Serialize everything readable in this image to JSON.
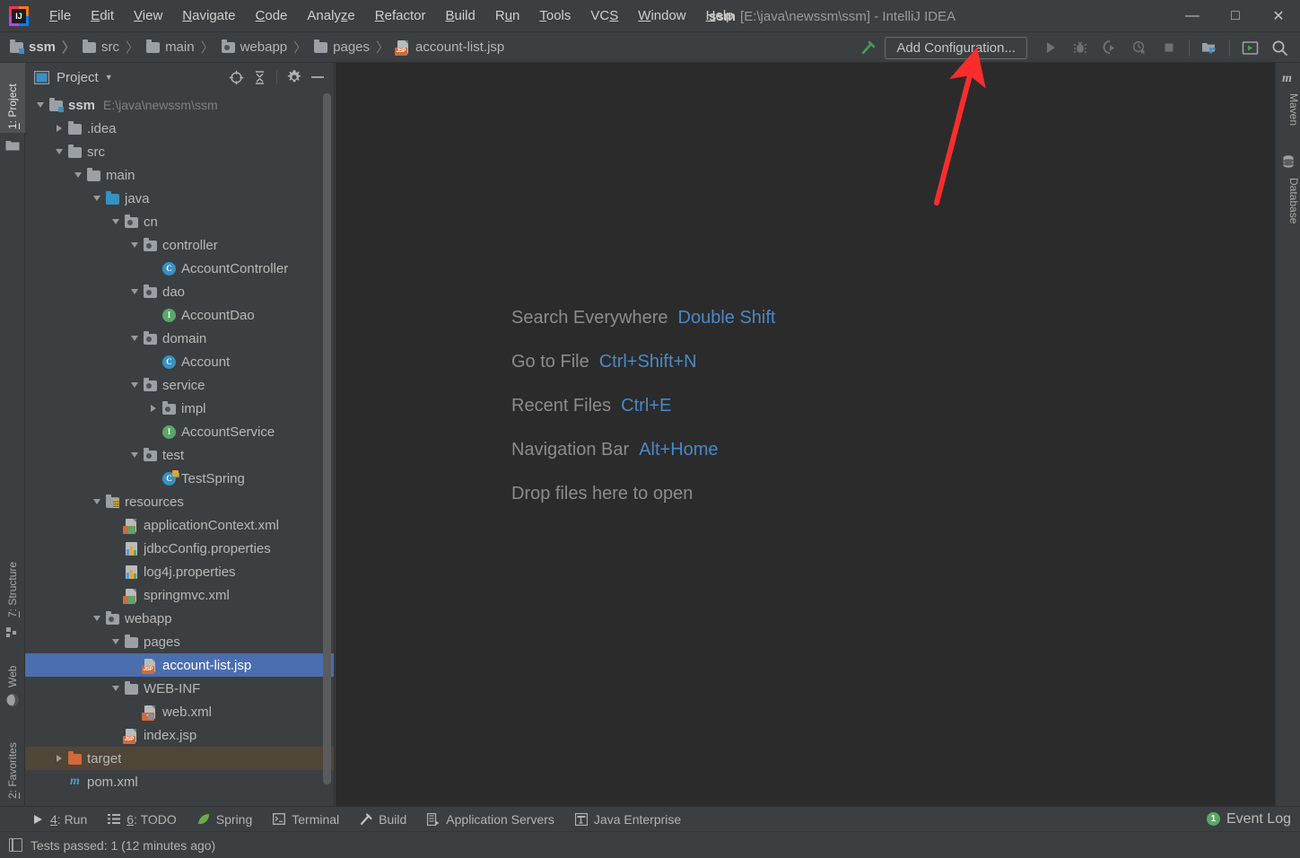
{
  "window": {
    "title_project": "ssm",
    "title_rest": "[E:\\java\\newssm\\ssm] - IntelliJ IDEA",
    "minimize": "—",
    "maximize": "□",
    "close": "✕"
  },
  "menubar": {
    "items": [
      {
        "label": "File",
        "mnemonic": "F"
      },
      {
        "label": "Edit",
        "mnemonic": "E"
      },
      {
        "label": "View",
        "mnemonic": "V"
      },
      {
        "label": "Navigate",
        "mnemonic": "N"
      },
      {
        "label": "Code",
        "mnemonic": "C"
      },
      {
        "label": "Analyze",
        "mnemonic": "z"
      },
      {
        "label": "Refactor",
        "mnemonic": "R"
      },
      {
        "label": "Build",
        "mnemonic": "B"
      },
      {
        "label": "Run",
        "mnemonic": "u"
      },
      {
        "label": "Tools",
        "mnemonic": "T"
      },
      {
        "label": "VCS",
        "mnemonic": "S"
      },
      {
        "label": "Window",
        "mnemonic": "W"
      },
      {
        "label": "Help",
        "mnemonic": "H"
      }
    ]
  },
  "navbar": {
    "crumbs": [
      {
        "label": "ssm",
        "icon": "module-folder-icon",
        "bold": true
      },
      {
        "label": "src",
        "icon": "folder-icon",
        "bold": false
      },
      {
        "label": "main",
        "icon": "folder-icon",
        "bold": false
      },
      {
        "label": "webapp",
        "icon": "package-folder-icon",
        "bold": false
      },
      {
        "label": "pages",
        "icon": "folder-icon",
        "bold": false
      },
      {
        "label": "account-list.jsp",
        "icon": "jsp-file-icon",
        "bold": false
      }
    ],
    "separator": "〉",
    "add_configuration": "Add Configuration...",
    "icons": [
      "build-hammer-icon",
      "run-icon",
      "debug-icon",
      "run-coverage-icon",
      "profiler-icon",
      "stop-icon",
      "project-structure-icon",
      "console-icon",
      "search-icon"
    ]
  },
  "left_stripe": {
    "tabs": [
      {
        "label": "1: Project",
        "mnemonic": "1",
        "active": true,
        "icon": "project-folder-icon"
      },
      {
        "label": "7: Structure",
        "mnemonic": "7",
        "active": false,
        "icon": "structure-icon"
      },
      {
        "label": "Web",
        "mnemonic": "",
        "active": false,
        "icon": "web-globe-icon"
      },
      {
        "label": "2: Favorites",
        "mnemonic": "2",
        "active": false,
        "icon": "star-icon"
      }
    ]
  },
  "right_stripe": {
    "tabs": [
      {
        "label": "Maven",
        "icon": "maven-m-icon"
      },
      {
        "label": "Database",
        "icon": "database-icon"
      }
    ]
  },
  "project_panel": {
    "title": "Project",
    "caret": "▼",
    "actions": [
      "locate-target-icon",
      "collapse-all-icon",
      "gear-icon",
      "hide-icon"
    ],
    "tree": [
      {
        "label": "ssm",
        "sub": "E:\\java\\newssm\\ssm",
        "depth": 0,
        "expand": "down",
        "icon": "module-folder-icon",
        "bold": true,
        "state": "normal"
      },
      {
        "label": ".idea",
        "sub": "",
        "depth": 1,
        "expand": "right",
        "icon": "folder-icon",
        "bold": false,
        "state": "normal"
      },
      {
        "label": "src",
        "sub": "",
        "depth": 1,
        "expand": "down",
        "icon": "folder-icon",
        "bold": false,
        "state": "normal"
      },
      {
        "label": "main",
        "sub": "",
        "depth": 2,
        "expand": "down",
        "icon": "folder-icon",
        "bold": false,
        "state": "normal"
      },
      {
        "label": "java",
        "sub": "",
        "depth": 3,
        "expand": "down",
        "icon": "source-folder-icon",
        "bold": false,
        "state": "normal"
      },
      {
        "label": "cn",
        "sub": "",
        "depth": 4,
        "expand": "down",
        "icon": "package-folder-icon",
        "bold": false,
        "state": "normal"
      },
      {
        "label": "controller",
        "sub": "",
        "depth": 5,
        "expand": "down",
        "icon": "package-folder-icon",
        "bold": false,
        "state": "normal"
      },
      {
        "label": "AccountController",
        "sub": "",
        "depth": 6,
        "expand": "none",
        "icon": "java-class-icon",
        "bold": false,
        "state": "normal"
      },
      {
        "label": "dao",
        "sub": "",
        "depth": 5,
        "expand": "down",
        "icon": "package-folder-icon",
        "bold": false,
        "state": "normal"
      },
      {
        "label": "AccountDao",
        "sub": "",
        "depth": 6,
        "expand": "none",
        "icon": "java-interface-icon",
        "bold": false,
        "state": "normal"
      },
      {
        "label": "domain",
        "sub": "",
        "depth": 5,
        "expand": "down",
        "icon": "package-folder-icon",
        "bold": false,
        "state": "normal"
      },
      {
        "label": "Account",
        "sub": "",
        "depth": 6,
        "expand": "none",
        "icon": "java-class-icon",
        "bold": false,
        "state": "normal"
      },
      {
        "label": "service",
        "sub": "",
        "depth": 5,
        "expand": "down",
        "icon": "package-folder-icon",
        "bold": false,
        "state": "normal"
      },
      {
        "label": "impl",
        "sub": "",
        "depth": 6,
        "expand": "right",
        "icon": "package-folder-icon",
        "bold": false,
        "state": "normal"
      },
      {
        "label": "AccountService",
        "sub": "",
        "depth": 6,
        "expand": "none",
        "icon": "java-interface-icon",
        "bold": false,
        "state": "normal"
      },
      {
        "label": "test",
        "sub": "",
        "depth": 5,
        "expand": "down",
        "icon": "package-folder-icon",
        "bold": false,
        "state": "normal"
      },
      {
        "label": "TestSpring",
        "sub": "",
        "depth": 6,
        "expand": "none",
        "icon": "java-test-class-icon",
        "bold": false,
        "state": "normal"
      },
      {
        "label": "resources",
        "sub": "",
        "depth": 3,
        "expand": "down",
        "icon": "resources-folder-icon",
        "bold": false,
        "state": "normal"
      },
      {
        "label": "applicationContext.xml",
        "sub": "",
        "depth": 4,
        "expand": "none",
        "icon": "spring-xml-file-icon",
        "bold": false,
        "state": "normal"
      },
      {
        "label": "jdbcConfig.properties",
        "sub": "",
        "depth": 4,
        "expand": "none",
        "icon": "properties-file-icon",
        "bold": false,
        "state": "normal"
      },
      {
        "label": "log4j.properties",
        "sub": "",
        "depth": 4,
        "expand": "none",
        "icon": "properties-file-icon",
        "bold": false,
        "state": "normal"
      },
      {
        "label": "springmvc.xml",
        "sub": "",
        "depth": 4,
        "expand": "none",
        "icon": "spring-xml-file-icon",
        "bold": false,
        "state": "normal"
      },
      {
        "label": "webapp",
        "sub": "",
        "depth": 3,
        "expand": "down",
        "icon": "package-folder-icon",
        "bold": false,
        "state": "normal"
      },
      {
        "label": "pages",
        "sub": "",
        "depth": 4,
        "expand": "down",
        "icon": "folder-icon",
        "bold": false,
        "state": "normal"
      },
      {
        "label": "account-list.jsp",
        "sub": "",
        "depth": 5,
        "expand": "none",
        "icon": "jsp-file-icon",
        "bold": false,
        "state": "selected"
      },
      {
        "label": "WEB-INF",
        "sub": "",
        "depth": 4,
        "expand": "down",
        "icon": "folder-icon",
        "bold": false,
        "state": "normal"
      },
      {
        "label": "web.xml",
        "sub": "",
        "depth": 5,
        "expand": "none",
        "icon": "web-xml-file-icon",
        "bold": false,
        "state": "normal"
      },
      {
        "label": "index.jsp",
        "sub": "",
        "depth": 4,
        "expand": "none",
        "icon": "jsp-file-icon",
        "bold": false,
        "state": "normal"
      },
      {
        "label": "target",
        "sub": "",
        "depth": 1,
        "expand": "right",
        "icon": "excluded-folder-icon",
        "bold": false,
        "state": "excluded"
      },
      {
        "label": "pom.xml",
        "sub": "",
        "depth": 1,
        "expand": "none",
        "icon": "maven-pom-icon",
        "bold": false,
        "state": "normal"
      }
    ]
  },
  "editor": {
    "hints": [
      {
        "action": "Search Everywhere",
        "shortcut": "Double Shift"
      },
      {
        "action": "Go to File",
        "shortcut": "Ctrl+Shift+N"
      },
      {
        "action": "Recent Files",
        "shortcut": "Ctrl+E"
      },
      {
        "action": "Navigation Bar",
        "shortcut": "Alt+Home"
      },
      {
        "action": "Drop files here to open",
        "shortcut": ""
      }
    ]
  },
  "annotation": {
    "type": "red-arrow",
    "color": "#f92d2d",
    "points_to": "Add Configuration..."
  },
  "bottom_bar": {
    "items": [
      {
        "label": "4: Run",
        "mnemonic": "4",
        "icon": "run-triangle-icon"
      },
      {
        "label": "6: TODO",
        "mnemonic": "6",
        "icon": "todo-list-icon"
      },
      {
        "label": "Spring",
        "mnemonic": "",
        "icon": "spring-leaf-icon"
      },
      {
        "label": "Terminal",
        "mnemonic": "",
        "icon": "terminal-icon"
      },
      {
        "label": "Build",
        "mnemonic": "",
        "icon": "build-hammer-icon"
      },
      {
        "label": "Application Servers",
        "mnemonic": "",
        "icon": "app-servers-icon"
      },
      {
        "label": "Java Enterprise",
        "mnemonic": "",
        "icon": "java-enterprise-icon"
      }
    ],
    "event_log": {
      "label": "Event Log",
      "count": "1"
    }
  },
  "status_bar": {
    "message": "Tests passed: 1 (12 minutes ago)",
    "icon": "memory-indicator-icon"
  },
  "colors": {
    "panel_bg": "#3c3f41",
    "editor_bg": "#2b2b2b",
    "selection_blue": "#4b6eaf",
    "excluded_olive": "#4f4637",
    "hint_key_blue": "#4a88c7",
    "arrow_red": "#f92d2d",
    "green_badge": "#59a869"
  }
}
